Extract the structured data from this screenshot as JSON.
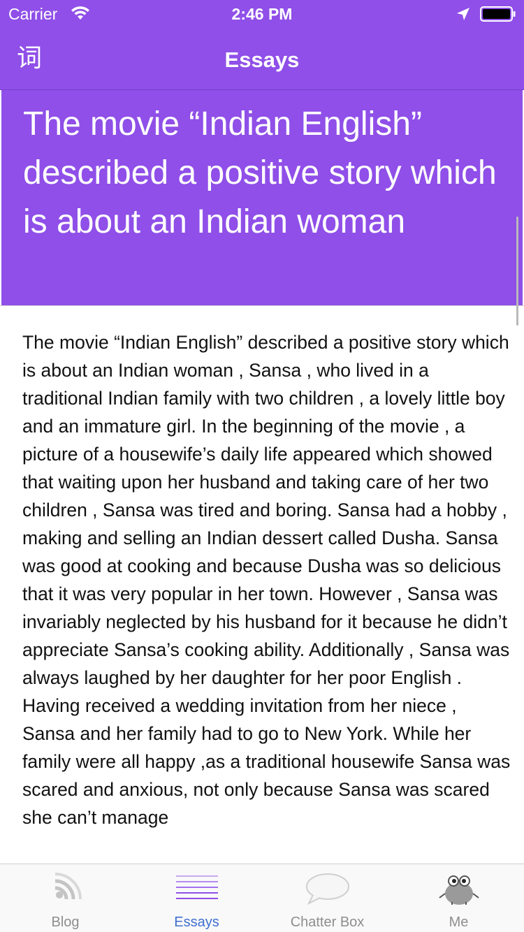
{
  "status_bar": {
    "carrier": "Carrier",
    "time": "2:46 PM"
  },
  "nav": {
    "title": "Essays",
    "dict_button": "词"
  },
  "article": {
    "title": "The movie “Indian English” described a positive story which is about an Indian woman",
    "body": "The movie “Indian English” described a positive story which is about an Indian woman , Sansa , who lived in a traditional Indian family with two children , a lovely little boy and an immature girl. In the beginning of the movie , a picture of a housewife’s daily life appeared which showed that waiting upon her husband and taking care of her two children , Sansa was tired and boring. Sansa had a hobby , making and selling an Indian dessert called Dusha. Sansa was good at cooking and because Dusha was so delicious that it was very popular in her town. However , Sansa was invariably neglected by his husband for it because he didn’t appreciate Sansa’s cooking ability. Additionally , Sansa was always laughed by her daughter for her poor English . Having received a wedding invitation from her niece , Sansa and her family had to go to New York. While her family were all happy ,as a traditional housewife Sansa was scared and anxious, not only because Sansa was scared she can’t manage"
  },
  "tabbar": {
    "tabs": [
      {
        "label": "Blog",
        "icon": "blog-icon",
        "active": false
      },
      {
        "label": "Essays",
        "icon": "essays-icon",
        "active": true
      },
      {
        "label": "Chatter Box",
        "icon": "chat-bubble-icon",
        "active": false
      },
      {
        "label": "Me",
        "icon": "owl-avatar-icon",
        "active": false
      }
    ]
  },
  "colors": {
    "accent": "#8f4fe8",
    "tab_active": "#3f6fd0",
    "tab_inactive": "#8e8e8e"
  }
}
